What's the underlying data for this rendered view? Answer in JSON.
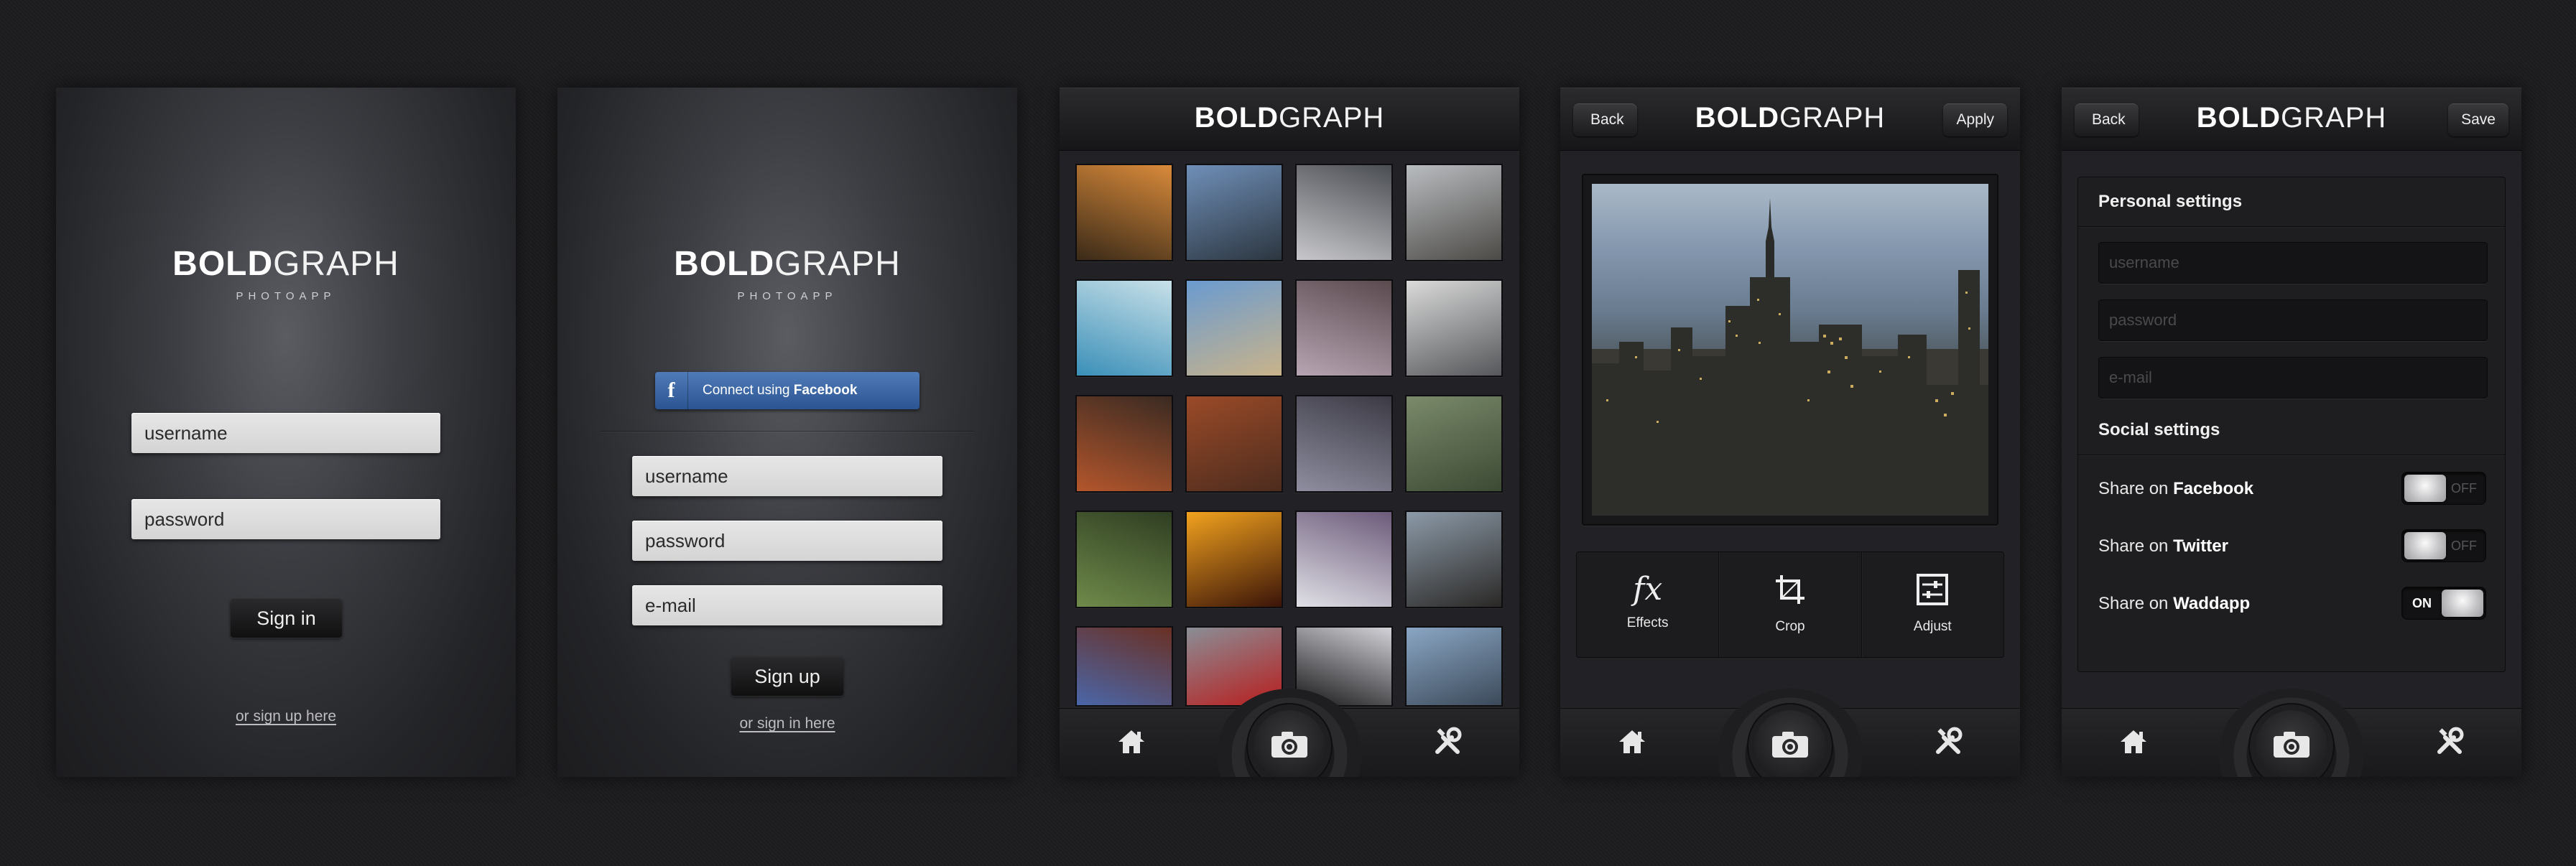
{
  "logo": {
    "bold": "BOLD",
    "light": "GRAPH",
    "tagline": "PHOTOAPP"
  },
  "signin_screen": {
    "username_value": "username",
    "password_value": "password",
    "sign_in_label": "Sign in",
    "signup_link": "or sign up here"
  },
  "signup_screen": {
    "facebook_prefix": "Connect using",
    "facebook_brand": "Facebook",
    "username_value": "username",
    "password_value": "password",
    "email_value": "e-mail",
    "sign_up_label": "Sign up",
    "signin_link": "or sign in here"
  },
  "gallery_screen": {
    "thumbs": [
      {
        "icon": "city-night-photo",
        "c1": "#3a2a18",
        "c2": "#d98a3a"
      },
      {
        "icon": "skyline-photo",
        "c1": "#6f8fb8",
        "c2": "#2c3640"
      },
      {
        "icon": "bridge-photo",
        "c1": "#c8c8cc",
        "c2": "#4a4d52"
      },
      {
        "icon": "beach-rocks-photo",
        "c1": "#b9bcc0",
        "c2": "#4c4a46"
      },
      {
        "icon": "hot-spring-photo",
        "c1": "#3a8fb8",
        "c2": "#c8e0e8"
      },
      {
        "icon": "dead-tree-photo",
        "c1": "#6a9bd0",
        "c2": "#c9b38a"
      },
      {
        "icon": "pink-sky-photo",
        "c1": "#b7a5b3",
        "c2": "#5a4a4e"
      },
      {
        "icon": "geyser-photo",
        "c1": "#dadada",
        "c2": "#55575a"
      },
      {
        "icon": "canyon-road-photo",
        "c1": "#b4562c",
        "c2": "#3a2a22"
      },
      {
        "icon": "red-rocks-photo",
        "c1": "#9a4a28",
        "c2": "#4d2c1e"
      },
      {
        "icon": "lake-tree-photo",
        "c1": "#8f8ea0",
        "c2": "#3b3a44"
      },
      {
        "icon": "squirrel-photo",
        "c1": "#7a8a6a",
        "c2": "#3c4a34"
      },
      {
        "icon": "white-flower-photo",
        "c1": "#6f8a4a",
        "c2": "#2f3e22"
      },
      {
        "icon": "fire-photo",
        "c1": "#f2a21e",
        "c2": "#3a1408"
      },
      {
        "icon": "fountain-photo",
        "c1": "#e0e0e6",
        "c2": "#6c5a7a"
      },
      {
        "icon": "castle-skyline-photo",
        "c1": "#8c9aa8",
        "c2": "#2a2826"
      },
      {
        "icon": "crowd-girl-photo",
        "c1": "#4a66a8",
        "c2": "#6a3024"
      },
      {
        "icon": "red-car-photo",
        "c1": "#8a8e96",
        "c2": "#b81e1e"
      },
      {
        "icon": "night-lights-photo",
        "c1": "#18181a",
        "c2": "#d2d2d8"
      },
      {
        "icon": "city-aerial-photo",
        "c1": "#8aa6c4",
        "c2": "#3c4a5a"
      }
    ]
  },
  "edit_screen": {
    "back_label": "Back",
    "apply_label": "Apply",
    "tools": [
      {
        "icon": "fx-icon",
        "label": "Effects"
      },
      {
        "icon": "crop-icon",
        "label": "Crop"
      },
      {
        "icon": "adjust-icon",
        "label": "Adjust"
      }
    ]
  },
  "settings_screen": {
    "back_label": "Back",
    "save_label": "Save",
    "personal_title": "Personal settings",
    "username_placeholder": "username",
    "password_placeholder": "password",
    "email_placeholder": "e-mail",
    "social_title": "Social settings",
    "share_prefix": "Share on",
    "shares": [
      {
        "service": "Facebook",
        "state": "OFF"
      },
      {
        "service": "Twitter",
        "state": "OFF"
      },
      {
        "service": "Waddapp",
        "state": "ON"
      }
    ]
  },
  "tabbar": {
    "home_icon": "home-icon",
    "camera_icon": "camera-icon",
    "tools_icon": "tools-icon"
  }
}
